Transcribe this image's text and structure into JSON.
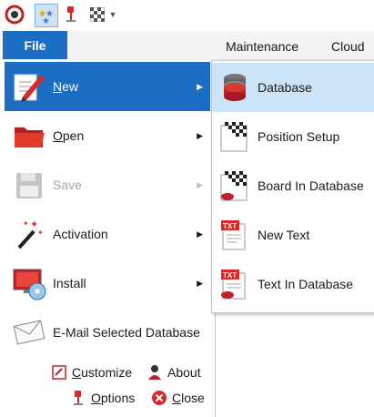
{
  "ribbon": {
    "file_tab": "File",
    "tabs": [
      "Maintenance",
      "Cloud"
    ]
  },
  "quick_access": [
    "app-logo-icon",
    "stars-icon",
    "pin-icon",
    "board-icon",
    "dropdown-arrow-icon"
  ],
  "file_menu": {
    "items": [
      {
        "label": "New",
        "accel": "N",
        "rest": "ew",
        "icon": "pencil-icon",
        "state": "selected",
        "has_submenu": true
      },
      {
        "label": "Open",
        "accel": "O",
        "rest": "pen",
        "icon": "folder-icon",
        "state": "normal",
        "has_submenu": true
      },
      {
        "label": "Save",
        "icon": "floppy-disk-icon",
        "state": "disabled",
        "has_submenu": true
      },
      {
        "label": "Activation",
        "icon": "magic-wand-icon",
        "state": "normal",
        "has_submenu": true
      },
      {
        "label": "Install",
        "icon": "monitor-disc-icon",
        "state": "normal",
        "has_submenu": true
      },
      {
        "label": "E-Mail Selected Database",
        "icon": "envelope-icon",
        "state": "normal",
        "has_submenu": false
      }
    ],
    "bottom": {
      "customize": {
        "accel": "C",
        "rest": "ustomize"
      },
      "about": "About",
      "options": {
        "accel": "O",
        "rest": "ptions"
      },
      "close": {
        "accel": "C",
        "rest": "lose"
      }
    }
  },
  "new_submenu": {
    "items": [
      {
        "label": "Database",
        "icon": "database-icon",
        "highlighted": true
      },
      {
        "label": "Position Setup",
        "icon": "chessboard-icon"
      },
      {
        "label": "Board In Database",
        "icon": "chessboard-database-icon"
      },
      {
        "label": "New Text",
        "icon": "text-document-icon"
      },
      {
        "label": "Text In Database",
        "icon": "text-database-icon"
      }
    ]
  },
  "colors": {
    "accent": "#1b6ec2",
    "hover": "#cce4f7",
    "disabled": "#a6a6a6"
  }
}
